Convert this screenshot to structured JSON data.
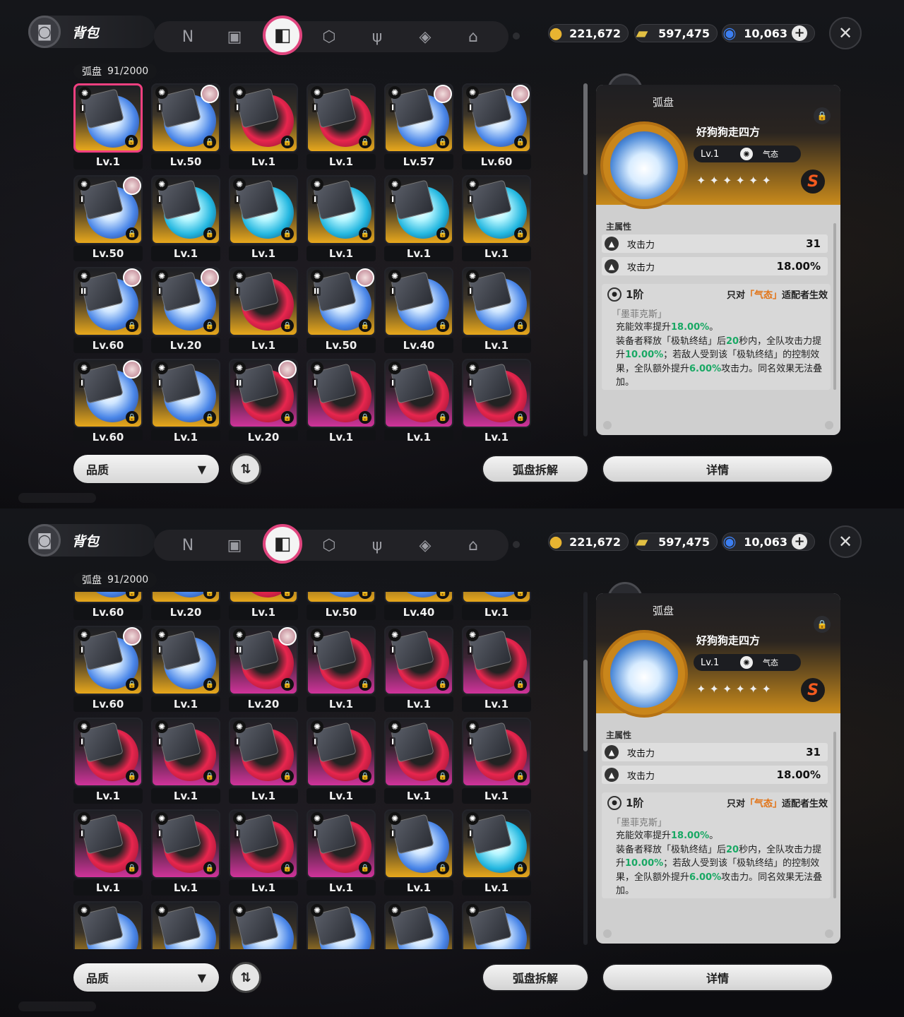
{
  "header": {
    "bag_title": "背包",
    "nav_tabs": [
      "n-icon",
      "gamepad-icon",
      "disc-icon",
      "cube-icon",
      "utensils-icon",
      "stone-icon",
      "home-icon"
    ],
    "currencies": [
      {
        "icon": "coin-icon",
        "value": "221,672"
      },
      {
        "icon": "ticket-icon",
        "value": "597,475"
      },
      {
        "icon": "gem-icon",
        "value": "10,063"
      }
    ],
    "plus": "+",
    "close": "✕"
  },
  "inventory": {
    "category": "弧盘",
    "count": "91/2000"
  },
  "screen_top": {
    "cells": [
      {
        "lv": "Lv.1",
        "tier": "I",
        "color": "gold",
        "art": "blue",
        "avatar": false,
        "selected": true
      },
      {
        "lv": "Lv.50",
        "tier": "I",
        "color": "gold",
        "art": "blue",
        "avatar": true
      },
      {
        "lv": "Lv.1",
        "tier": "I",
        "color": "gold",
        "art": "red",
        "avatar": false
      },
      {
        "lv": "Lv.1",
        "tier": "I",
        "color": "gold",
        "art": "red",
        "avatar": false
      },
      {
        "lv": "Lv.57",
        "tier": "I",
        "color": "gold",
        "art": "blue",
        "avatar": true
      },
      {
        "lv": "Lv.60",
        "tier": "I",
        "color": "gold",
        "art": "blue",
        "avatar": true
      },
      {
        "lv": "Lv.50",
        "tier": "I",
        "color": "gold",
        "art": "blue",
        "avatar": true
      },
      {
        "lv": "Lv.1",
        "tier": "I",
        "color": "gold",
        "art": "cyan",
        "avatar": false
      },
      {
        "lv": "Lv.1",
        "tier": "I",
        "color": "gold",
        "art": "cyan",
        "avatar": false
      },
      {
        "lv": "Lv.1",
        "tier": "I",
        "color": "gold",
        "art": "cyan",
        "avatar": false
      },
      {
        "lv": "Lv.1",
        "tier": "I",
        "color": "gold",
        "art": "cyan",
        "avatar": false
      },
      {
        "lv": "Lv.1",
        "tier": "I",
        "color": "gold",
        "art": "cyan",
        "avatar": false
      },
      {
        "lv": "Lv.60",
        "tier": "II",
        "color": "gold",
        "art": "blue",
        "avatar": true
      },
      {
        "lv": "Lv.20",
        "tier": "I",
        "color": "gold",
        "art": "blue",
        "avatar": true
      },
      {
        "lv": "Lv.1",
        "tier": "I",
        "color": "gold",
        "art": "red",
        "avatar": false
      },
      {
        "lv": "Lv.50",
        "tier": "II",
        "color": "gold",
        "art": "blue",
        "avatar": true
      },
      {
        "lv": "Lv.40",
        "tier": "I",
        "color": "gold",
        "art": "blue",
        "avatar": false
      },
      {
        "lv": "Lv.1",
        "tier": "I",
        "color": "gold",
        "art": "blue",
        "avatar": false
      },
      {
        "lv": "Lv.60",
        "tier": "I",
        "color": "gold",
        "art": "blue",
        "avatar": true
      },
      {
        "lv": "Lv.1",
        "tier": "I",
        "color": "gold",
        "art": "blue",
        "avatar": false
      },
      {
        "lv": "Lv.20",
        "tier": "II",
        "color": "purple",
        "art": "red",
        "avatar": true
      },
      {
        "lv": "Lv.1",
        "tier": "I",
        "color": "purple",
        "art": "red",
        "avatar": false
      },
      {
        "lv": "Lv.1",
        "tier": "I",
        "color": "purple",
        "art": "red",
        "avatar": false
      },
      {
        "lv": "Lv.1",
        "tier": "I",
        "color": "purple",
        "art": "red",
        "avatar": false
      }
    ]
  },
  "screen_bottom": {
    "cells": [
      {
        "lv": "Lv.60",
        "tier": "II",
        "color": "gold",
        "art": "blue",
        "avatar": true
      },
      {
        "lv": "Lv.20",
        "tier": "I",
        "color": "gold",
        "art": "blue",
        "avatar": true
      },
      {
        "lv": "Lv.1",
        "tier": "I",
        "color": "gold",
        "art": "red",
        "avatar": false
      },
      {
        "lv": "Lv.50",
        "tier": "II",
        "color": "gold",
        "art": "blue",
        "avatar": true
      },
      {
        "lv": "Lv.40",
        "tier": "I",
        "color": "gold",
        "art": "blue",
        "avatar": false
      },
      {
        "lv": "Lv.1",
        "tier": "I",
        "color": "gold",
        "art": "blue",
        "avatar": false
      },
      {
        "lv": "Lv.60",
        "tier": "I",
        "color": "gold",
        "art": "blue",
        "avatar": true
      },
      {
        "lv": "Lv.1",
        "tier": "I",
        "color": "gold",
        "art": "blue",
        "avatar": false
      },
      {
        "lv": "Lv.20",
        "tier": "II",
        "color": "purple",
        "art": "red",
        "avatar": true
      },
      {
        "lv": "Lv.1",
        "tier": "I",
        "color": "purple",
        "art": "red",
        "avatar": false
      },
      {
        "lv": "Lv.1",
        "tier": "I",
        "color": "purple",
        "art": "red",
        "avatar": false
      },
      {
        "lv": "Lv.1",
        "tier": "I",
        "color": "purple",
        "art": "red",
        "avatar": false
      },
      {
        "lv": "Lv.1",
        "tier": "I",
        "color": "purple",
        "art": "red",
        "avatar": false
      },
      {
        "lv": "Lv.1",
        "tier": "I",
        "color": "purple",
        "art": "red",
        "avatar": false
      },
      {
        "lv": "Lv.1",
        "tier": "I",
        "color": "purple",
        "art": "red",
        "avatar": false
      },
      {
        "lv": "Lv.1",
        "tier": "I",
        "color": "purple",
        "art": "red",
        "avatar": false
      },
      {
        "lv": "Lv.1",
        "tier": "I",
        "color": "purple",
        "art": "red",
        "avatar": false
      },
      {
        "lv": "Lv.1",
        "tier": "I",
        "color": "purple",
        "art": "red",
        "avatar": false
      },
      {
        "lv": "Lv.1",
        "tier": "I",
        "color": "purple",
        "art": "red",
        "avatar": false
      },
      {
        "lv": "Lv.1",
        "tier": "I",
        "color": "purple",
        "art": "red",
        "avatar": false
      },
      {
        "lv": "Lv.1",
        "tier": "I",
        "color": "purple",
        "art": "red",
        "avatar": false
      },
      {
        "lv": "Lv.1",
        "tier": "I",
        "color": "purple",
        "art": "red",
        "avatar": false
      },
      {
        "lv": "Lv.1",
        "tier": "I",
        "color": "gold",
        "art": "blue",
        "avatar": false
      },
      {
        "lv": "Lv.1",
        "tier": "I",
        "color": "gold",
        "art": "cyan",
        "avatar": false
      },
      {
        "lv": "",
        "tier": "",
        "color": "gold",
        "art": "blue",
        "avatar": false
      },
      {
        "lv": "",
        "tier": "",
        "color": "gold",
        "art": "blue",
        "avatar": false
      },
      {
        "lv": "",
        "tier": "",
        "color": "gold",
        "art": "blue",
        "avatar": false
      },
      {
        "lv": "",
        "tier": "",
        "color": "gold",
        "art": "blue",
        "avatar": false
      },
      {
        "lv": "",
        "tier": "",
        "color": "gold",
        "art": "blue",
        "avatar": false
      },
      {
        "lv": "",
        "tier": "",
        "color": "gold",
        "art": "blue",
        "avatar": false
      }
    ]
  },
  "detail": {
    "type": "弧盘",
    "name": "好狗狗走四方",
    "level": "Lv.1",
    "element": "气态",
    "stars": "✦ ✦ ✦ ✦ ✦ ✦",
    "rank": "S",
    "attrs_title": "主属性",
    "attrs": [
      {
        "name": "攻击力",
        "value": "31"
      },
      {
        "name": "攻击力",
        "value": "18.00%"
      }
    ],
    "set_tier": "1阶",
    "set_cond_pre": "只对",
    "set_cond_hl": "「气态」",
    "set_cond_post": "适配者生效",
    "set_name": "「墨菲克斯」",
    "set_line1_a": "充能效率提升",
    "set_line1_b": "18.00%",
    "set_line1_c": "。",
    "set_line2_a": "装备者释放「极轨终结」后",
    "set_line2_b": "20",
    "set_line2_c": "秒内，全队攻击力提升",
    "set_line2_d": "10.00%",
    "set_line2_e": "；若敌人受到该「极轨终结」的控制效果，全队额外提升",
    "set_line2_f": "6.00%",
    "set_line2_g": "攻击力。同名效果无法叠加。"
  },
  "controls": {
    "filter_label": "品质",
    "filter_caret": "▼",
    "sort_icon": "⇅",
    "dismantle_label": "弧盘拆解",
    "details_label": "详情"
  },
  "colors": {
    "accent_pink": "#e0457e",
    "gold": "#e8a81c",
    "purple": "#d0339a",
    "highlight_green": "#19a864",
    "highlight_orange": "#e27315"
  }
}
